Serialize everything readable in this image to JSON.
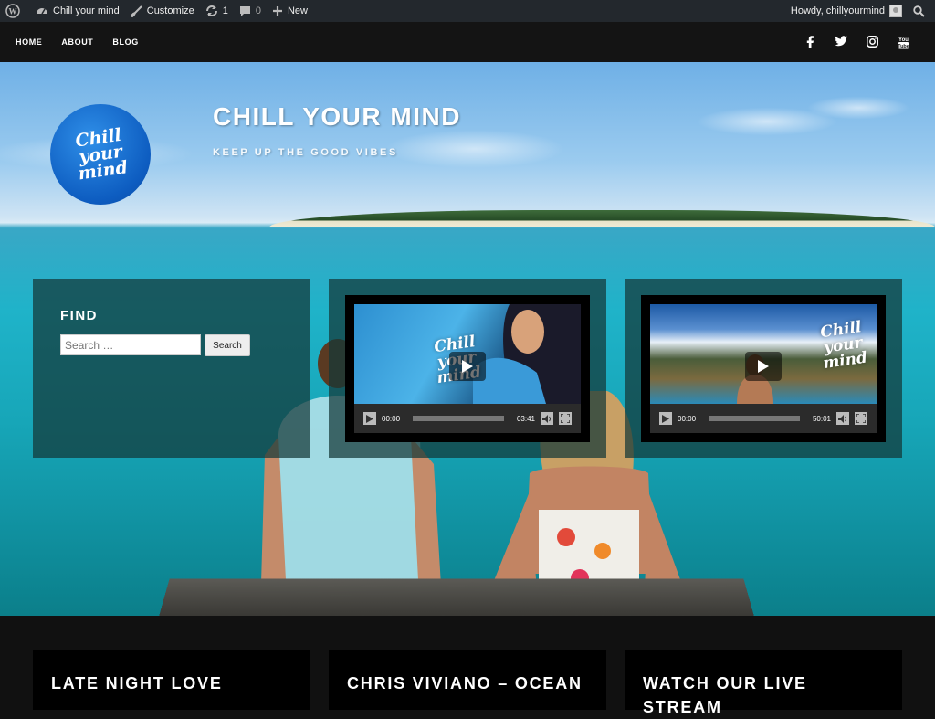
{
  "adminbar": {
    "wp_logo_icon": "wordpress-icon",
    "site_name": "Chill your mind",
    "customize": "Customize",
    "updates_count": "1",
    "comments_count": "0",
    "new_label": "New",
    "greeting": "Howdy, chillyourmind"
  },
  "nav": {
    "items": [
      "HOME",
      "ABOUT",
      "BLOG"
    ],
    "social": [
      "facebook-icon",
      "twitter-icon",
      "instagram-icon",
      "youtube-icon"
    ]
  },
  "hero": {
    "logo_text": [
      "Chill",
      "your",
      "mind"
    ],
    "title": "CHILL YOUR MIND",
    "tagline": "KEEP UP THE GOOD VIBES"
  },
  "find": {
    "title": "FIND",
    "placeholder": "Search …",
    "button": "Search"
  },
  "videos": [
    {
      "current_time": "00:00",
      "duration": "03:41",
      "brand": [
        "Chill",
        "your",
        "mind"
      ]
    },
    {
      "current_time": "00:00",
      "duration": "50:01",
      "brand": [
        "Chill",
        "your",
        "mind"
      ]
    }
  ],
  "posts": [
    {
      "title": "LATE NIGHT LOVE"
    },
    {
      "title": "CHRIS VIVIANO – OCEAN"
    },
    {
      "title": "WATCH OUR LIVE STREAM"
    }
  ],
  "colors": {
    "adminbar": "#23282d",
    "nav": "#141414",
    "widget_overlay": "#143737"
  }
}
